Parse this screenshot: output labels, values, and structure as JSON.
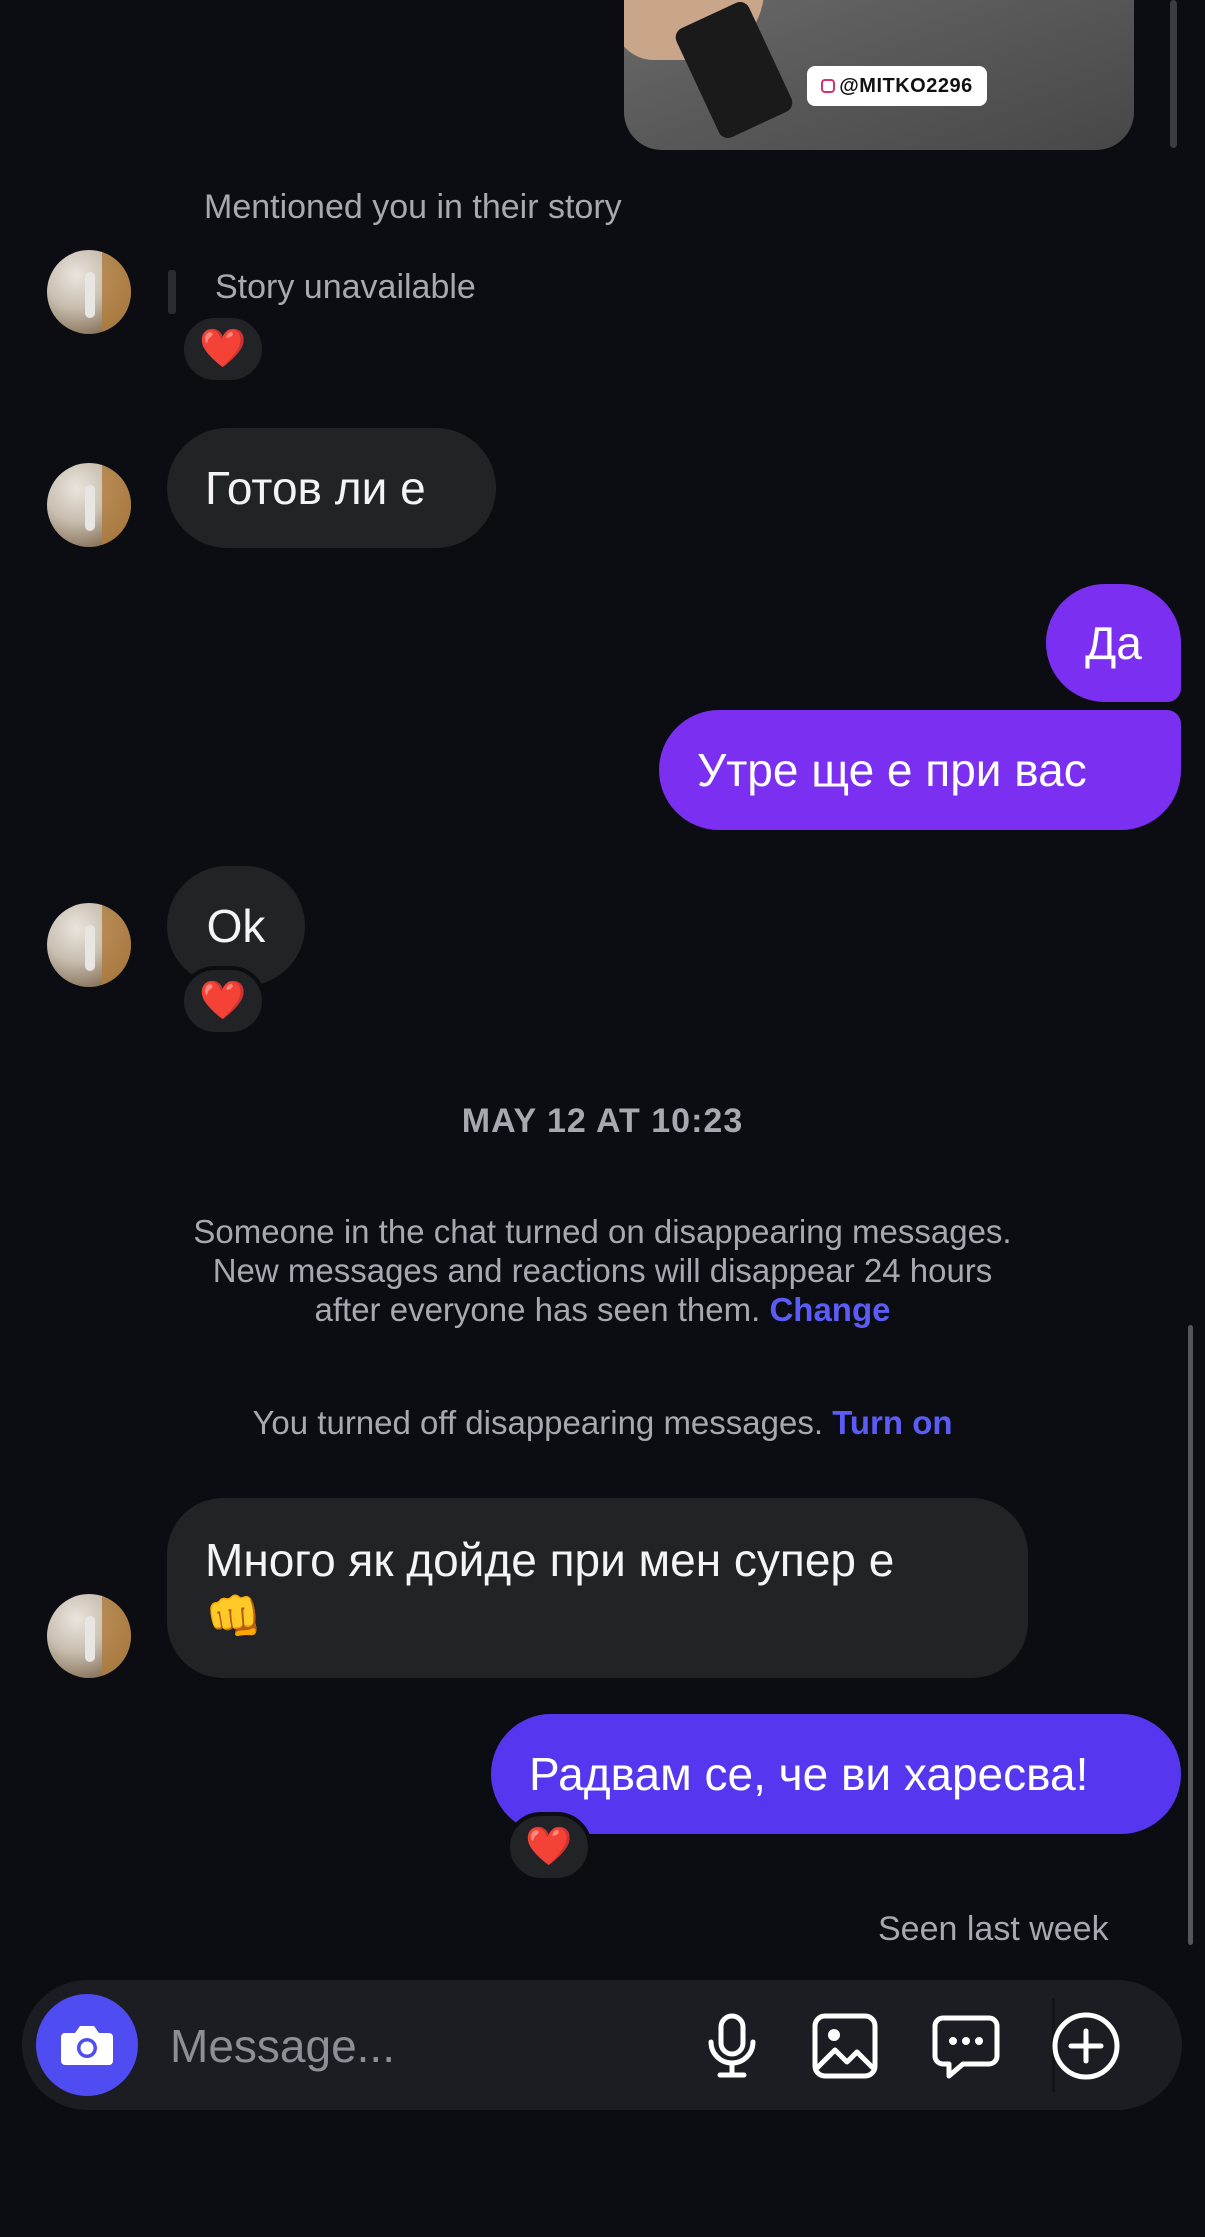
{
  "story": {
    "tag_text": "@MITKO2296",
    "mention_text": "Mentioned you in their story",
    "unavailable_text": "Story unavailable",
    "reaction": "❤️"
  },
  "messages": [
    {
      "sender": "them",
      "text": "Готов ли е"
    },
    {
      "sender": "me",
      "text": "Да"
    },
    {
      "sender": "me",
      "text": "Утре ще е при вас"
    },
    {
      "sender": "them",
      "text": "Ok",
      "reaction": "❤️"
    }
  ],
  "timestamp": "MAY 12 AT 10:23",
  "notice_disappearing": {
    "line1": "Someone in the chat turned on disappearing messages.",
    "line2": "New messages and reactions will disappear 24 hours",
    "line3": "after everyone has seen them.",
    "link": "Change"
  },
  "notice_off": {
    "text": "You turned off disappearing messages.",
    "link": "Turn on"
  },
  "later_messages": [
    {
      "sender": "them",
      "line1": "Много як дойде при мен супер е",
      "line2": "👊"
    },
    {
      "sender": "me",
      "text": "Радвам се, че ви харесва!",
      "reaction": "❤️"
    }
  ],
  "seen_text": "Seen last week",
  "composer": {
    "placeholder": "Message...",
    "icons": [
      "camera-icon",
      "microphone-icon",
      "gallery-icon",
      "sticker-chat-icon",
      "plus-icon"
    ]
  },
  "colors": {
    "background": "#0c0d12",
    "incoming_bubble": "#222327",
    "outgoing_purple": "#7b2ff0",
    "outgoing_blue": "#5637ef",
    "link": "#5b5cf6",
    "camera_button": "#4f4cf2"
  }
}
